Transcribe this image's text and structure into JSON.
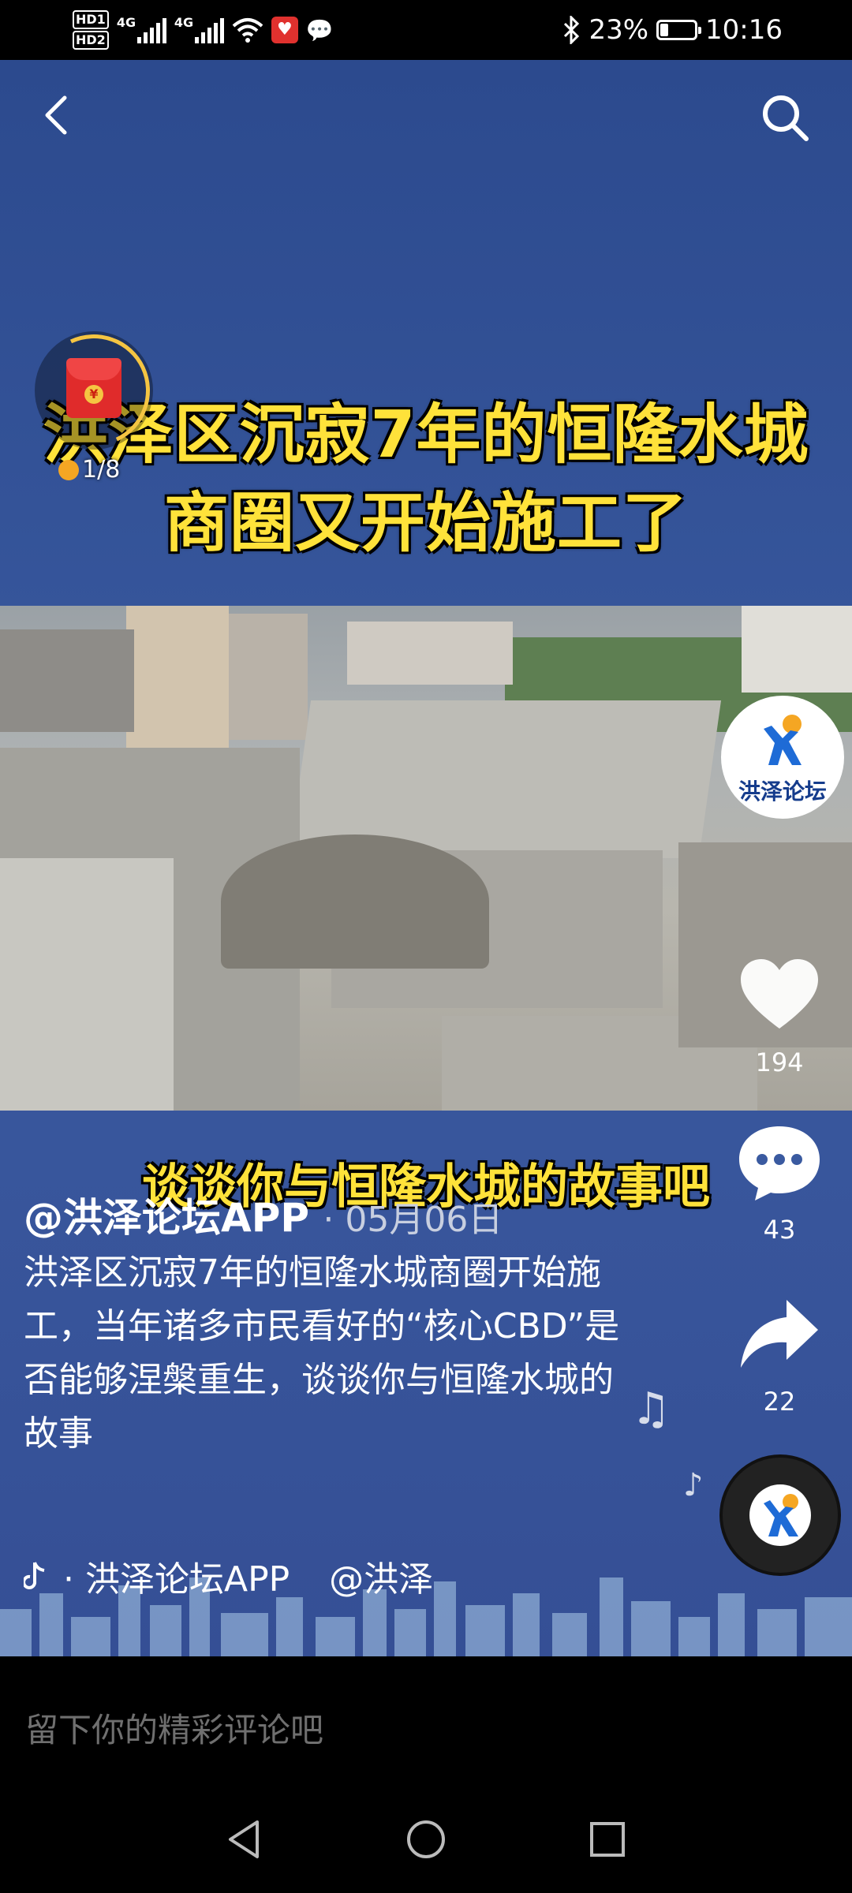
{
  "status_bar": {
    "hd1": "HD1",
    "hd2": "HD2",
    "net1": "4G",
    "net2": "4G",
    "battery_text": "23%",
    "battery_level": 0.23,
    "time": "10:16",
    "icons": [
      "sim-signal-icon",
      "wifi-icon",
      "app-notification-icon",
      "wechat-icon",
      "bluetooth-icon",
      "battery-icon"
    ]
  },
  "video": {
    "headline_line1": "洪泽区沉寂7年的恒隆水城",
    "headline_line2": "商圈又开始施工了",
    "subcaption": "谈谈你与恒隆水城的故事吧",
    "red_packet_counter": "1/8"
  },
  "author_avatar_text": "洪泽论坛",
  "actions": {
    "likes": "194",
    "comments": "43",
    "shares": "22"
  },
  "post": {
    "author": "@洪泽论坛APP",
    "date": "· 05月06日",
    "description": "洪泽区沉寂7年的恒隆水城商圈开始施工，当年诸多市民看好的“核心CBD”是否能够涅槃重生，谈谈你与恒隆水城的故事",
    "music_label": "· 洪泽论坛APP",
    "mention": "@洪泽"
  },
  "comment_bar": {
    "placeholder": "留下你的精彩评论吧"
  },
  "colors": {
    "video_bg": "#2f4f93",
    "caption_yellow": "#ffe23a"
  }
}
